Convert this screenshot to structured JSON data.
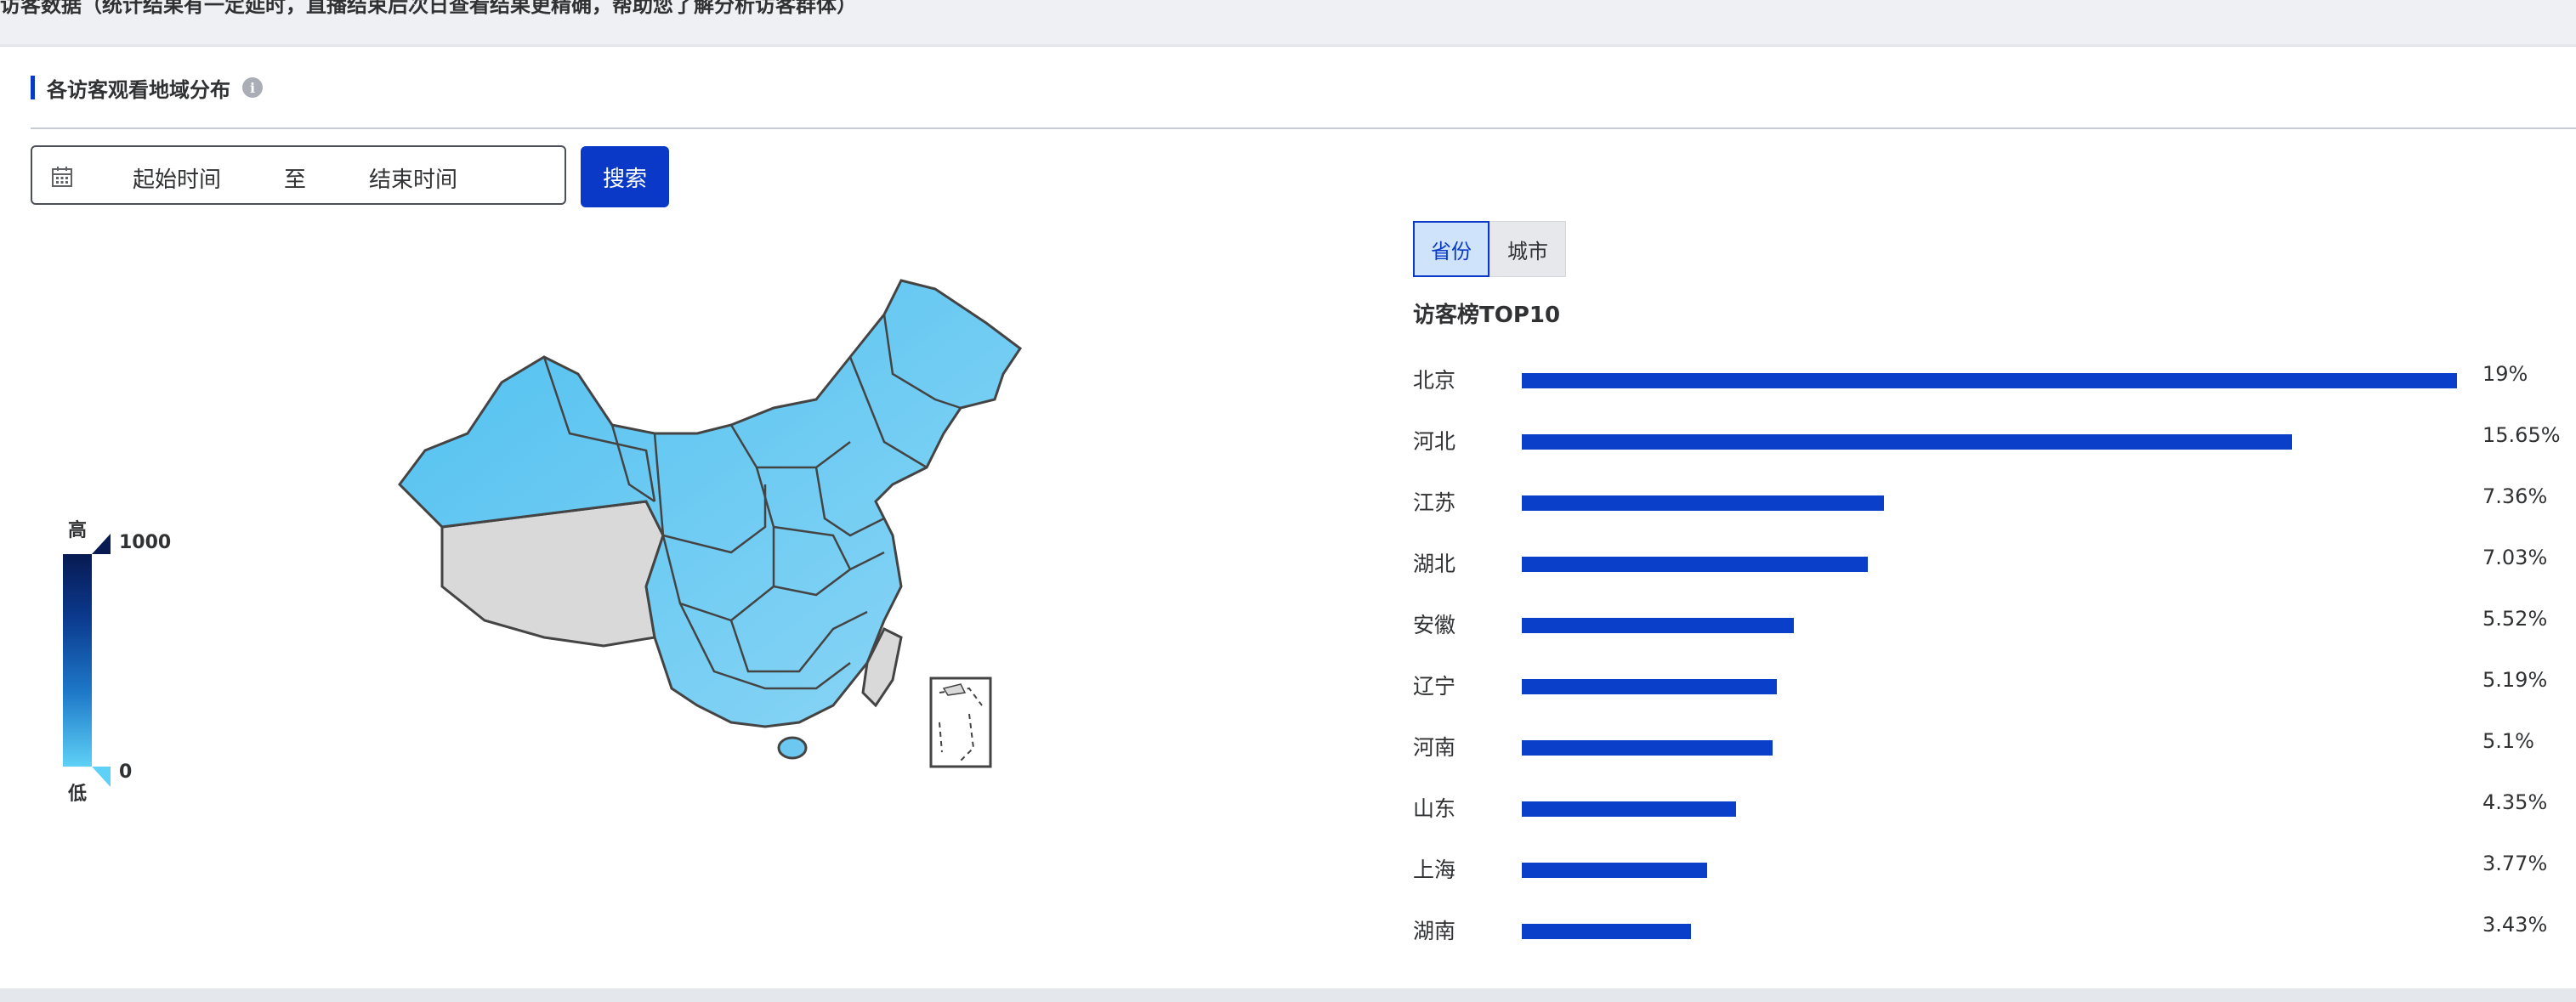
{
  "header": {
    "title": "访客数据（统计结果有一定延时，直播结束后次日查看结果更精确，帮助您了解分析访客群体）"
  },
  "section": {
    "title": "各访客观看地域分布",
    "info_icon": "info-icon"
  },
  "date_range": {
    "start_placeholder": "起始时间",
    "separator": "至",
    "end_placeholder": "结束时间",
    "icon": "calendar-icon"
  },
  "search_button": {
    "label": "搜索"
  },
  "legend": {
    "high_label": "高",
    "low_label": "低",
    "max_value": "1000",
    "min_value": "0"
  },
  "tabs": [
    {
      "label": "省份",
      "active": true
    },
    {
      "label": "城市",
      "active": false
    }
  ],
  "ranking": {
    "title": "访客榜TOP10",
    "items": [
      {
        "name": "北京",
        "percent": "19%",
        "value": 19
      },
      {
        "name": "河北",
        "percent": "15.65%",
        "value": 15.65
      },
      {
        "name": "江苏",
        "percent": "7.36%",
        "value": 7.36
      },
      {
        "name": "湖北",
        "percent": "7.03%",
        "value": 7.03
      },
      {
        "name": "安徽",
        "percent": "5.52%",
        "value": 5.52
      },
      {
        "name": "辽宁",
        "percent": "5.19%",
        "value": 5.19
      },
      {
        "name": "河南",
        "percent": "5.1%",
        "value": 5.1
      },
      {
        "name": "山东",
        "percent": "4.35%",
        "value": 4.35
      },
      {
        "name": "上海",
        "percent": "3.77%",
        "value": 3.77
      },
      {
        "name": "湖南",
        "percent": "3.43%",
        "value": 3.43
      }
    ]
  },
  "colors": {
    "accent": "#0a39c8",
    "bar": "#0a3fc9",
    "map_fill": "#6cc8f0",
    "map_nodata": "#d9d9d9"
  }
}
